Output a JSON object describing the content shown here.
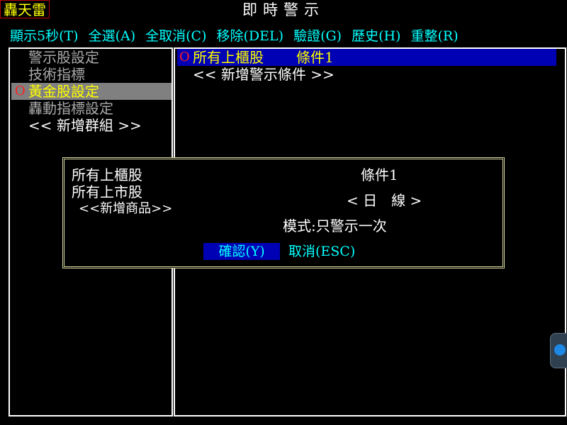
{
  "app": {
    "logo": "轟天雷",
    "title": "即時警示"
  },
  "menu": [
    "顯示5秒(T)",
    "全選(A)",
    "全取消(C)",
    "移除(DEL)",
    "驗證(G)",
    "歷史(H)",
    "重整(R)"
  ],
  "groups": [
    {
      "label": "警示股設定",
      "style": "dim"
    },
    {
      "label": "技術指標",
      "style": "dim"
    },
    {
      "label": "黃金股設定",
      "style": "yellow",
      "selected": true,
      "marker": "O"
    },
    {
      "label": "轟動指標設定",
      "style": "dim"
    },
    {
      "label": "<< 新增群組 >>",
      "style": "white"
    }
  ],
  "conditions": [
    {
      "marker": "O",
      "label": "所有上櫃股",
      "condition": "條件1",
      "selected": true
    },
    {
      "label": "<< 新增警示條件 >>",
      "add": true
    }
  ],
  "dialog": {
    "products": [
      "所有上櫃股",
      "所有上市股",
      "<<新增商品>>"
    ],
    "condition_name": "條件1",
    "period": "< 日　線 >",
    "mode": "模式:只警示一次",
    "confirm": "確認(Y)",
    "cancel": "取消(ESC)"
  },
  "colors": {
    "menu": "#00ffff",
    "highlight_blue": "#0000b4",
    "selected_gray": "#808080",
    "accent_yellow": "#ffff00",
    "marker_red": "#ff2020"
  }
}
